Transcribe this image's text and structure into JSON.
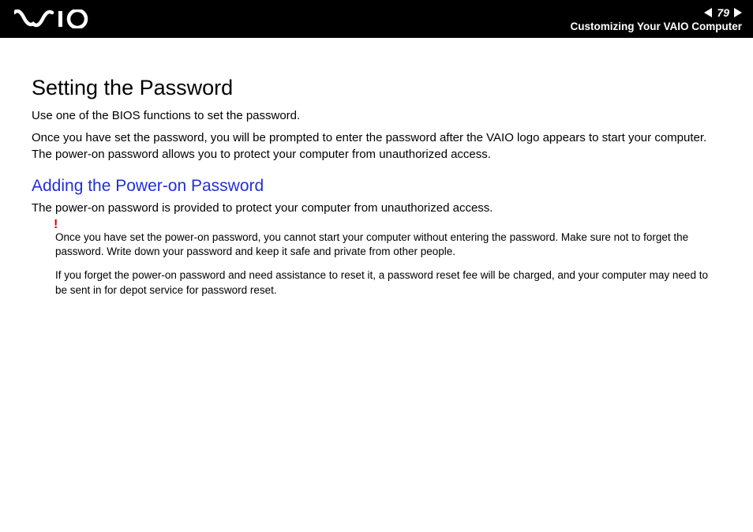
{
  "header": {
    "page_number": "79",
    "section": "Customizing Your VAIO Computer"
  },
  "content": {
    "title": "Setting the Password",
    "intro1": "Use one of the BIOS functions to set the password.",
    "intro2": "Once you have set the password, you will be prompted to enter the password after the VAIO logo appears to start your computer. The power-on password allows you to protect your computer from unauthorized access.",
    "subheading": "Adding the Power-on Password",
    "sub_intro": "The power-on password is provided to protect your computer from unauthorized access.",
    "warning_mark": "!",
    "warning1": "Once you have set the power-on password, you cannot start your computer without entering the password. Make sure not to forget the password. Write down your password and keep it safe and private from other people.",
    "warning2": "If you forget the power-on password and need assistance to reset it, a password reset fee will be charged, and your computer may need to be sent in for depot service for password reset."
  }
}
